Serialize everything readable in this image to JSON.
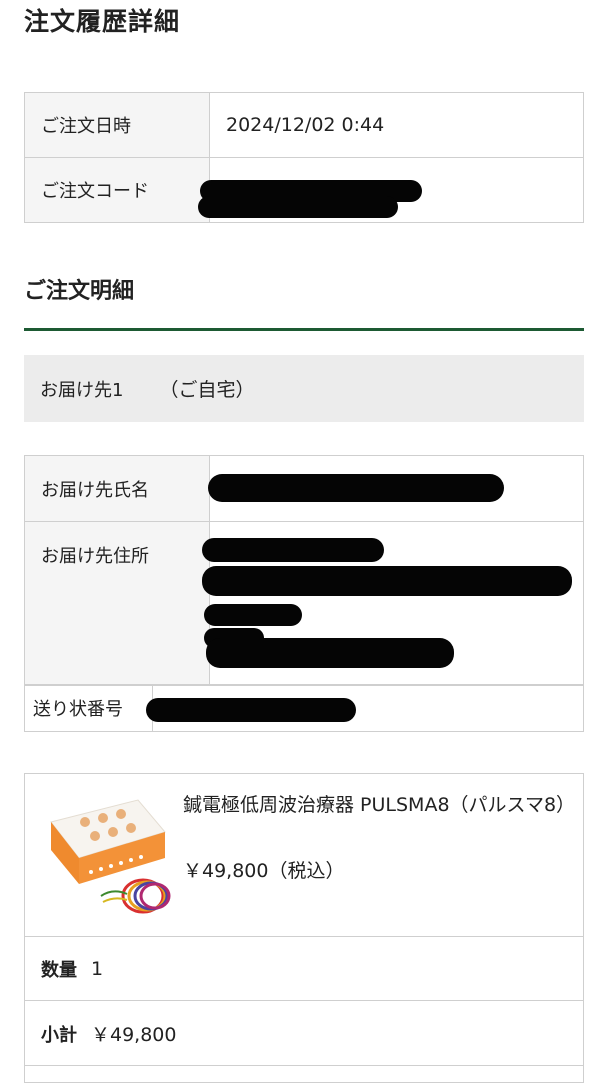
{
  "page": {
    "title": "注文履歴詳細"
  },
  "order": {
    "date_label": "ご注文日時",
    "date_value": "2024/12/02 0:44",
    "code_label": "ご注文コード"
  },
  "details": {
    "title": "ご注文明細",
    "accent_color": "#1d5a33"
  },
  "destination": {
    "label": "お届け先1",
    "sub": "（ご自宅）",
    "name_label": "お届け先氏名",
    "address_label": "お届け先住所",
    "tracking_label": "送り状番号"
  },
  "product": {
    "name": "鍼電極低周波治療器 PULSMA8（パルスマ8）",
    "price": "￥49,800（税込）",
    "quantity_label": "数量",
    "quantity_value": "1",
    "subtotal_label": "小計",
    "subtotal_value": "￥49,800"
  }
}
